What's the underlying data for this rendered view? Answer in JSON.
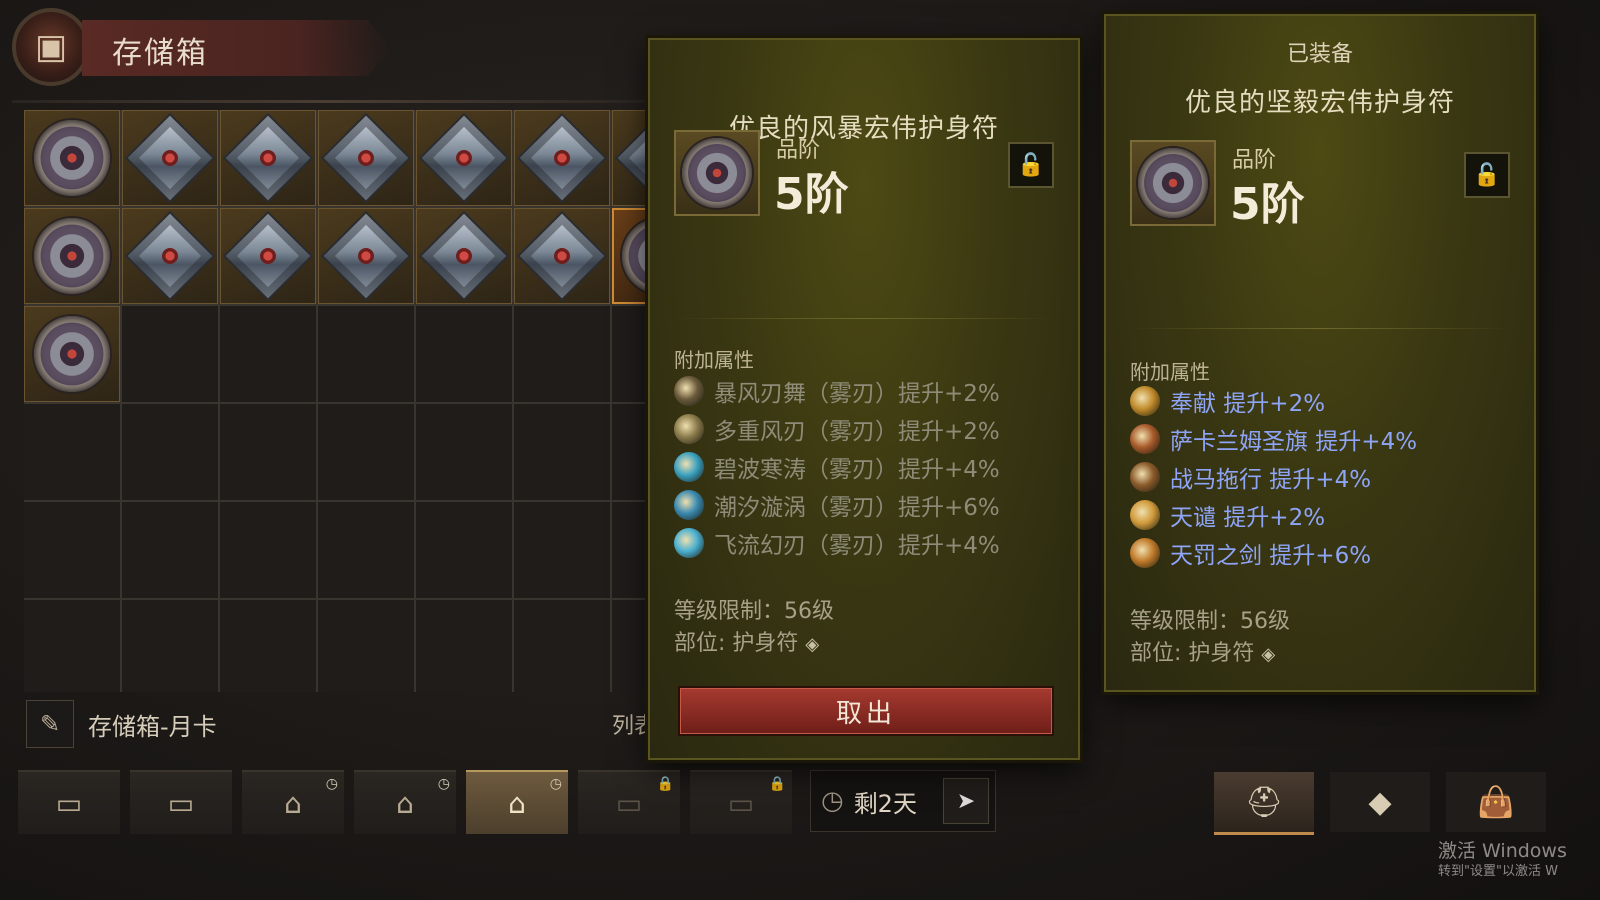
{
  "storage": {
    "title": "存储箱",
    "name": "存储箱-月卡",
    "list_label": "列表"
  },
  "grid": {
    "rows": [
      [
        "amulet",
        "charm",
        "charm",
        "charm",
        "charm",
        "charm",
        "charm"
      ],
      [
        "amulet",
        "charm",
        "charm",
        "charm",
        "charm",
        "charm",
        "amulet-selected"
      ],
      [
        "amulet",
        "",
        "",
        "",
        "",
        "",
        ""
      ],
      [
        "",
        "",
        "",
        "",
        "",
        "",
        ""
      ],
      [
        "",
        "",
        "",
        "",
        "",
        "",
        ""
      ],
      [
        "",
        "",
        "",
        "",
        "",
        "",
        ""
      ]
    ]
  },
  "tooltip": {
    "name": "优良的风暴宏伟护身符",
    "grade_label": "品阶",
    "grade_value": "5阶",
    "attr_title": "附加属性",
    "attributes": [
      {
        "text": "暴风刃舞（雾刃）提升+2%",
        "icon_color": "#6b5a3a"
      },
      {
        "text": "多重风刃（雾刃）提升+2%",
        "icon_color": "#8a7a4a"
      },
      {
        "text": "碧波寒涛（雾刃）提升+4%",
        "icon_color": "#3aa0c0"
      },
      {
        "text": "潮汐漩涡（雾刃）提升+6%",
        "icon_color": "#3a8ab0"
      },
      {
        "text": "飞流幻刃（雾刃）提升+4%",
        "icon_color": "#4ab0d0"
      }
    ],
    "level_req": "等级限制：56级",
    "slot": "部位: 护身符",
    "withdraw_button": "取出"
  },
  "equipped": {
    "label": "已装备",
    "name": "优良的坚毅宏伟护身符",
    "grade_label": "品阶",
    "grade_value": "5阶",
    "attr_title": "附加属性",
    "attributes": [
      {
        "text": "奉献  提升+2%",
        "icon_color": "#c08a2a"
      },
      {
        "text": "萨卡兰姆圣旗  提升+4%",
        "icon_color": "#a85a2a"
      },
      {
        "text": "战马拖行  提升+4%",
        "icon_color": "#8a5a2a"
      },
      {
        "text": "天谴  提升+2%",
        "icon_color": "#d09a3a"
      },
      {
        "text": "天罚之剑  提升+6%",
        "icon_color": "#c07a2a"
      }
    ],
    "level_req": "等级限制：56级",
    "slot": "部位: 护身符"
  },
  "tabs": [
    {
      "state": "normal",
      "badge": ""
    },
    {
      "state": "normal",
      "badge": ""
    },
    {
      "state": "normal",
      "badge": "◷"
    },
    {
      "state": "normal",
      "badge": "◷"
    },
    {
      "state": "active",
      "badge": "◷"
    },
    {
      "state": "locked",
      "badge": "🔒"
    },
    {
      "state": "locked",
      "badge": "🔒"
    }
  ],
  "timer": {
    "remaining": "剩2天"
  },
  "windows": {
    "line1": "激活 Windows",
    "line2": "转到\"设置\"以激活 W"
  }
}
